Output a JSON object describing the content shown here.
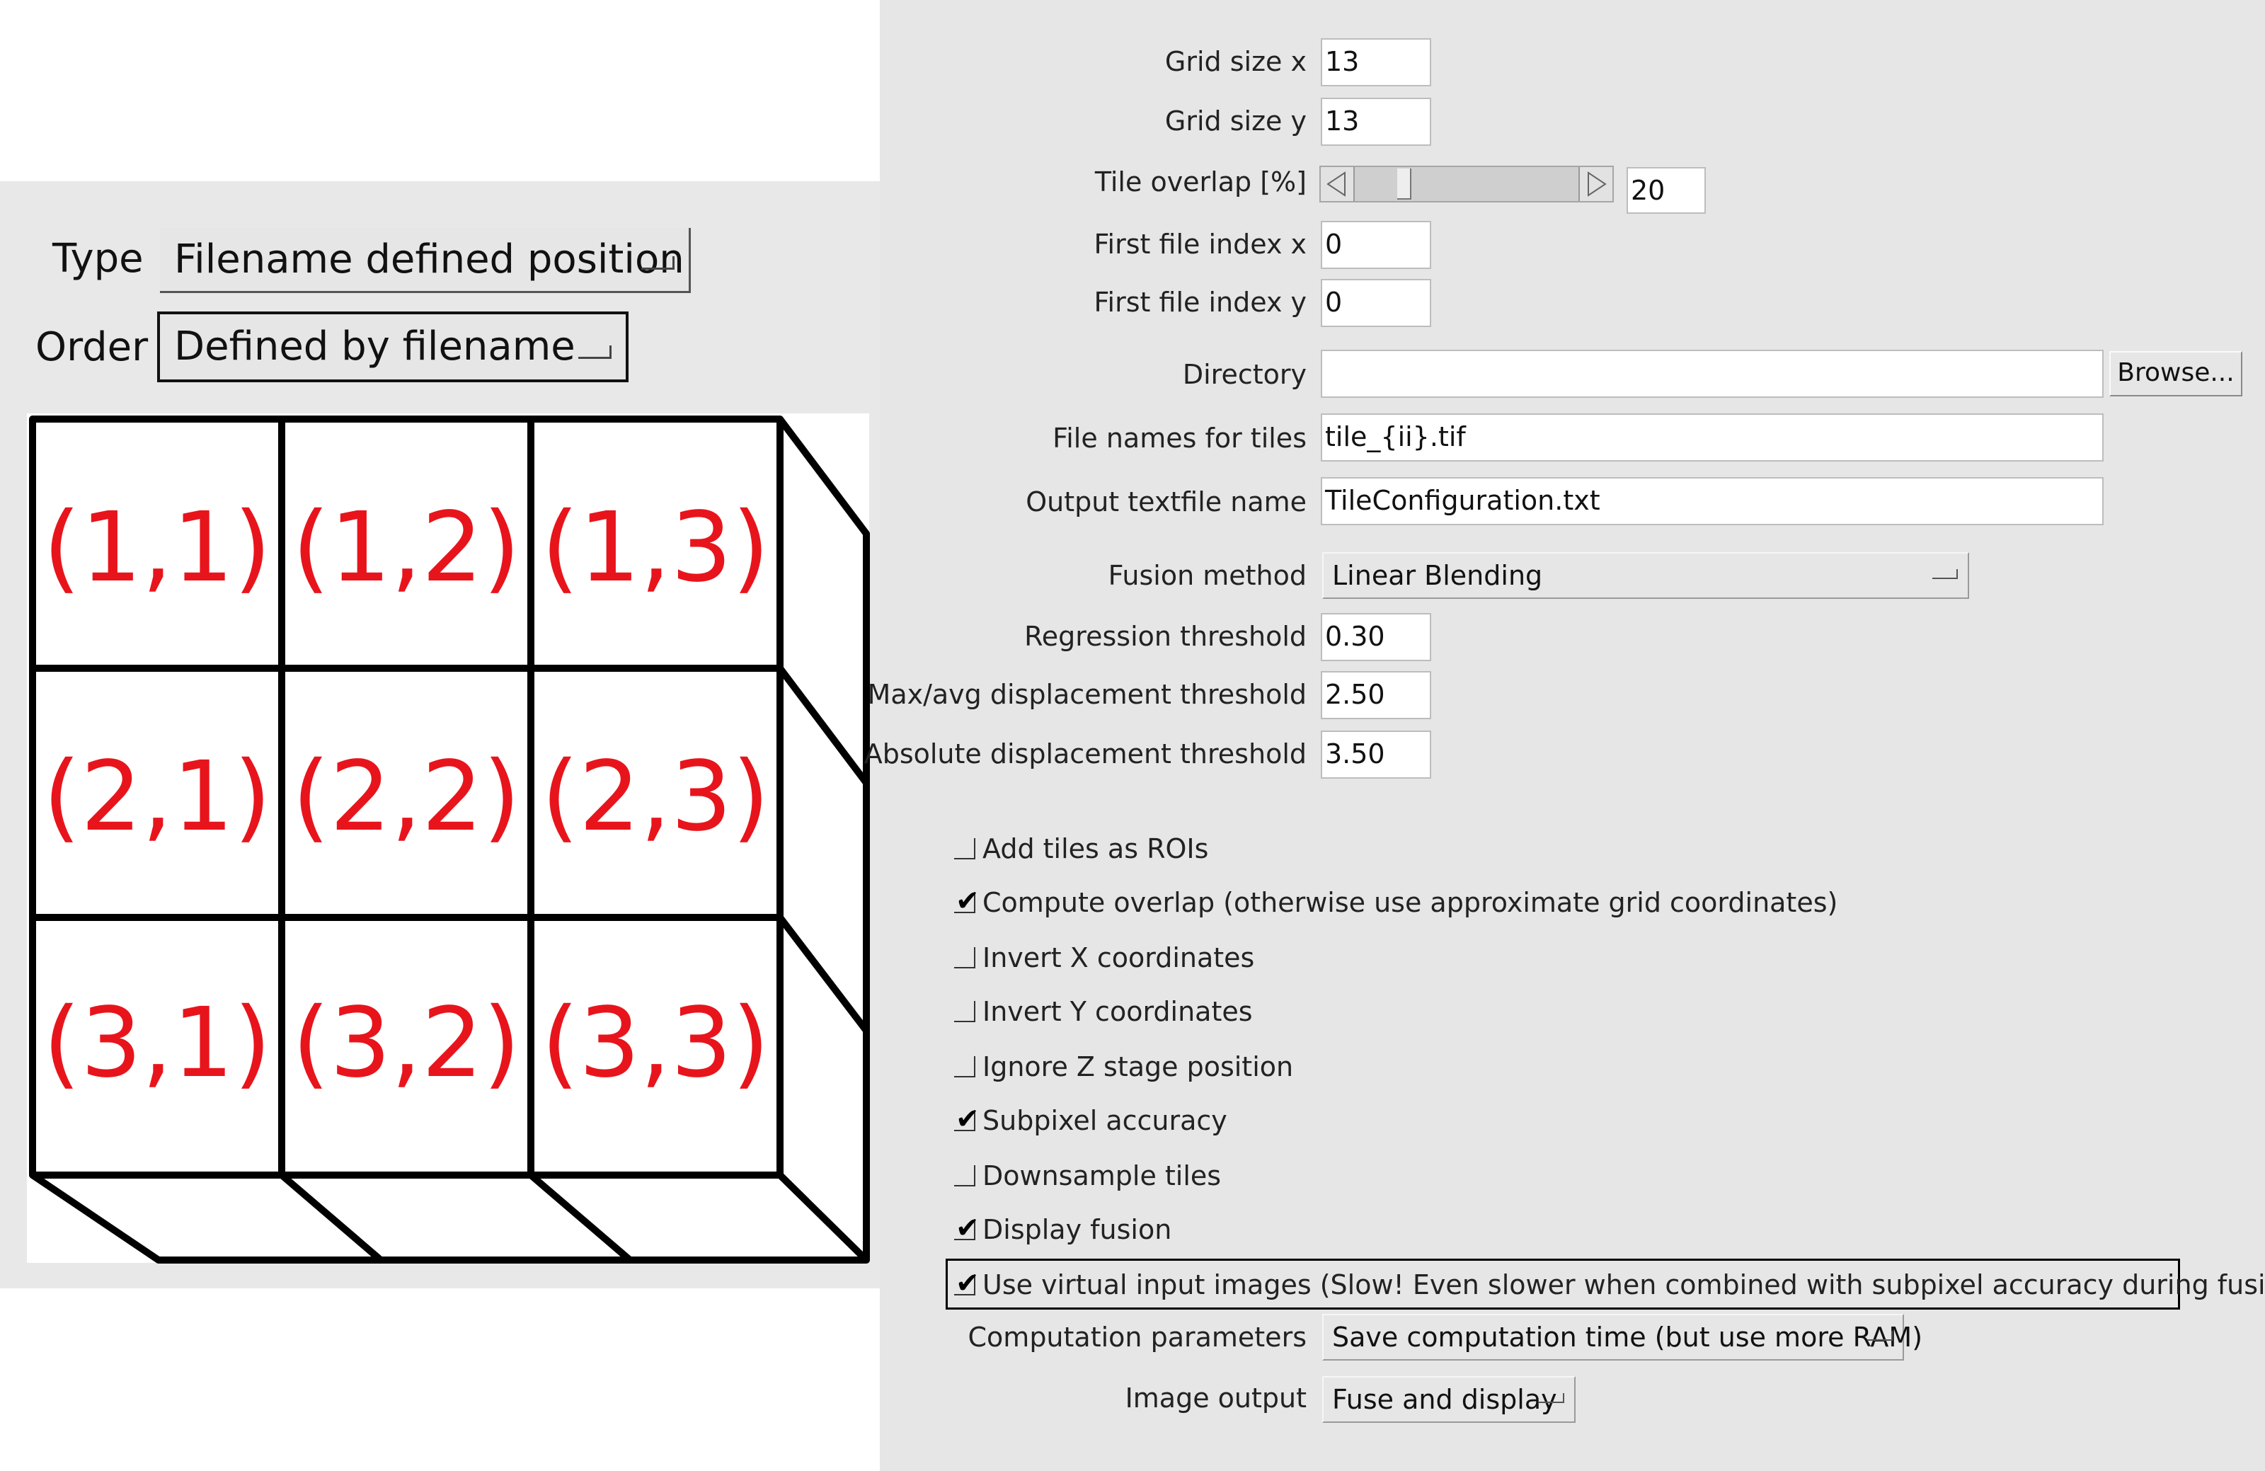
{
  "left": {
    "type_label": "Type",
    "type_value": "Filename defined position",
    "order_label": "Order",
    "order_value": "Defined by filename",
    "grid_cells": [
      "(1,1)",
      "(1,2)",
      "(1,3)",
      "(2,1)",
      "(2,2)",
      "(2,3)",
      "(3,1)",
      "(3,2)",
      "(3,3)"
    ]
  },
  "form": {
    "grid_size_x": {
      "label": "Grid size x",
      "value": "13"
    },
    "grid_size_y": {
      "label": "Grid size y",
      "value": "13"
    },
    "tile_overlap": {
      "label": "Tile overlap [%]",
      "value": "20",
      "slider_fraction": 0.2
    },
    "first_index_x": {
      "label": "First file index x",
      "value": "0"
    },
    "first_index_y": {
      "label": "First file index y",
      "value": "0"
    },
    "directory": {
      "label": "Directory",
      "value": "",
      "button": "Browse..."
    },
    "file_names": {
      "label": "File names for tiles",
      "value": "tile_{ii}.tif"
    },
    "output_name": {
      "label": "Output textfile name",
      "value": "TileConfiguration.txt"
    },
    "fusion_method": {
      "label": "Fusion method",
      "value": "Linear Blending"
    },
    "regression": {
      "label": "Regression threshold",
      "value": "0.30"
    },
    "max_avg": {
      "label": "Max/avg displacement threshold",
      "value": "2.50"
    },
    "absolute": {
      "label": "Absolute displacement threshold",
      "value": "3.50"
    },
    "computation": {
      "label": "Computation parameters",
      "value": "Save computation time (but use more RAM)"
    },
    "image_output": {
      "label": "Image output",
      "value": "Fuse and display"
    }
  },
  "checkboxes": [
    {
      "label": "Add tiles as ROIs",
      "checked": false
    },
    {
      "label": "Compute overlap (otherwise use approximate grid coordinates)",
      "checked": true
    },
    {
      "label": "Invert X coordinates",
      "checked": false
    },
    {
      "label": "Invert Y coordinates",
      "checked": false
    },
    {
      "label": "Ignore Z stage position",
      "checked": false
    },
    {
      "label": "Subpixel accuracy",
      "checked": true
    },
    {
      "label": "Downsample tiles",
      "checked": false
    },
    {
      "label": "Display fusion",
      "checked": true
    },
    {
      "label": "Use virtual input images (Slow! Even slower when combined with subpixel accuracy during fusion!)",
      "checked": true
    }
  ],
  "colors": {
    "cell_label": "#e8141c",
    "panel": "#e6e6e6"
  }
}
